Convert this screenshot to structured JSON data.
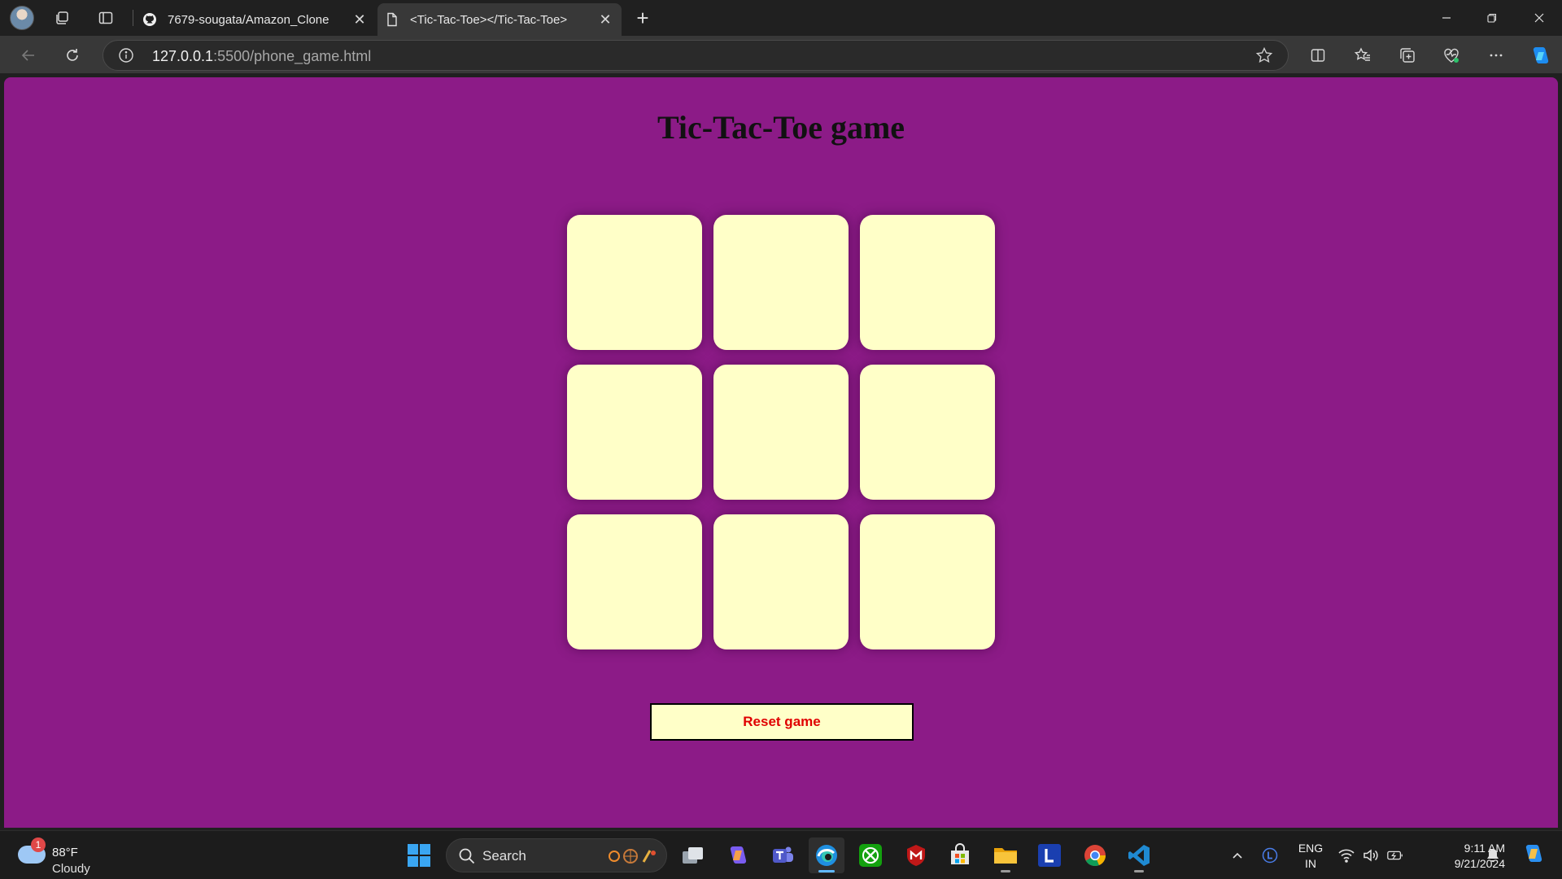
{
  "browser": {
    "tabs": [
      {
        "title": "7679-sougata/Amazon_Clone",
        "icon": "github-icon"
      },
      {
        "title": "<Tic-Tac-Toe></Tic-Tac-Toe>",
        "icon": "document-icon"
      }
    ],
    "url_host": "127.0.0.1",
    "url_rest": ":5500/phone_game.html"
  },
  "page": {
    "title": "Tic-Tac-Toe game",
    "cells": [
      "",
      "",
      "",
      "",
      "",
      "",
      "",
      "",
      ""
    ],
    "reset_label": "Reset game",
    "colors": {
      "background": "#8c1b87",
      "cell": "#ffffc8",
      "reset_text": "#e00000"
    }
  },
  "taskbar": {
    "weather_temp": "88°F",
    "weather_desc": "Cloudy",
    "weather_badge": "1",
    "search_placeholder": "Search",
    "lang_top": "ENG",
    "lang_bottom": "IN",
    "time": "9:11 AM",
    "date": "9/21/2024"
  }
}
